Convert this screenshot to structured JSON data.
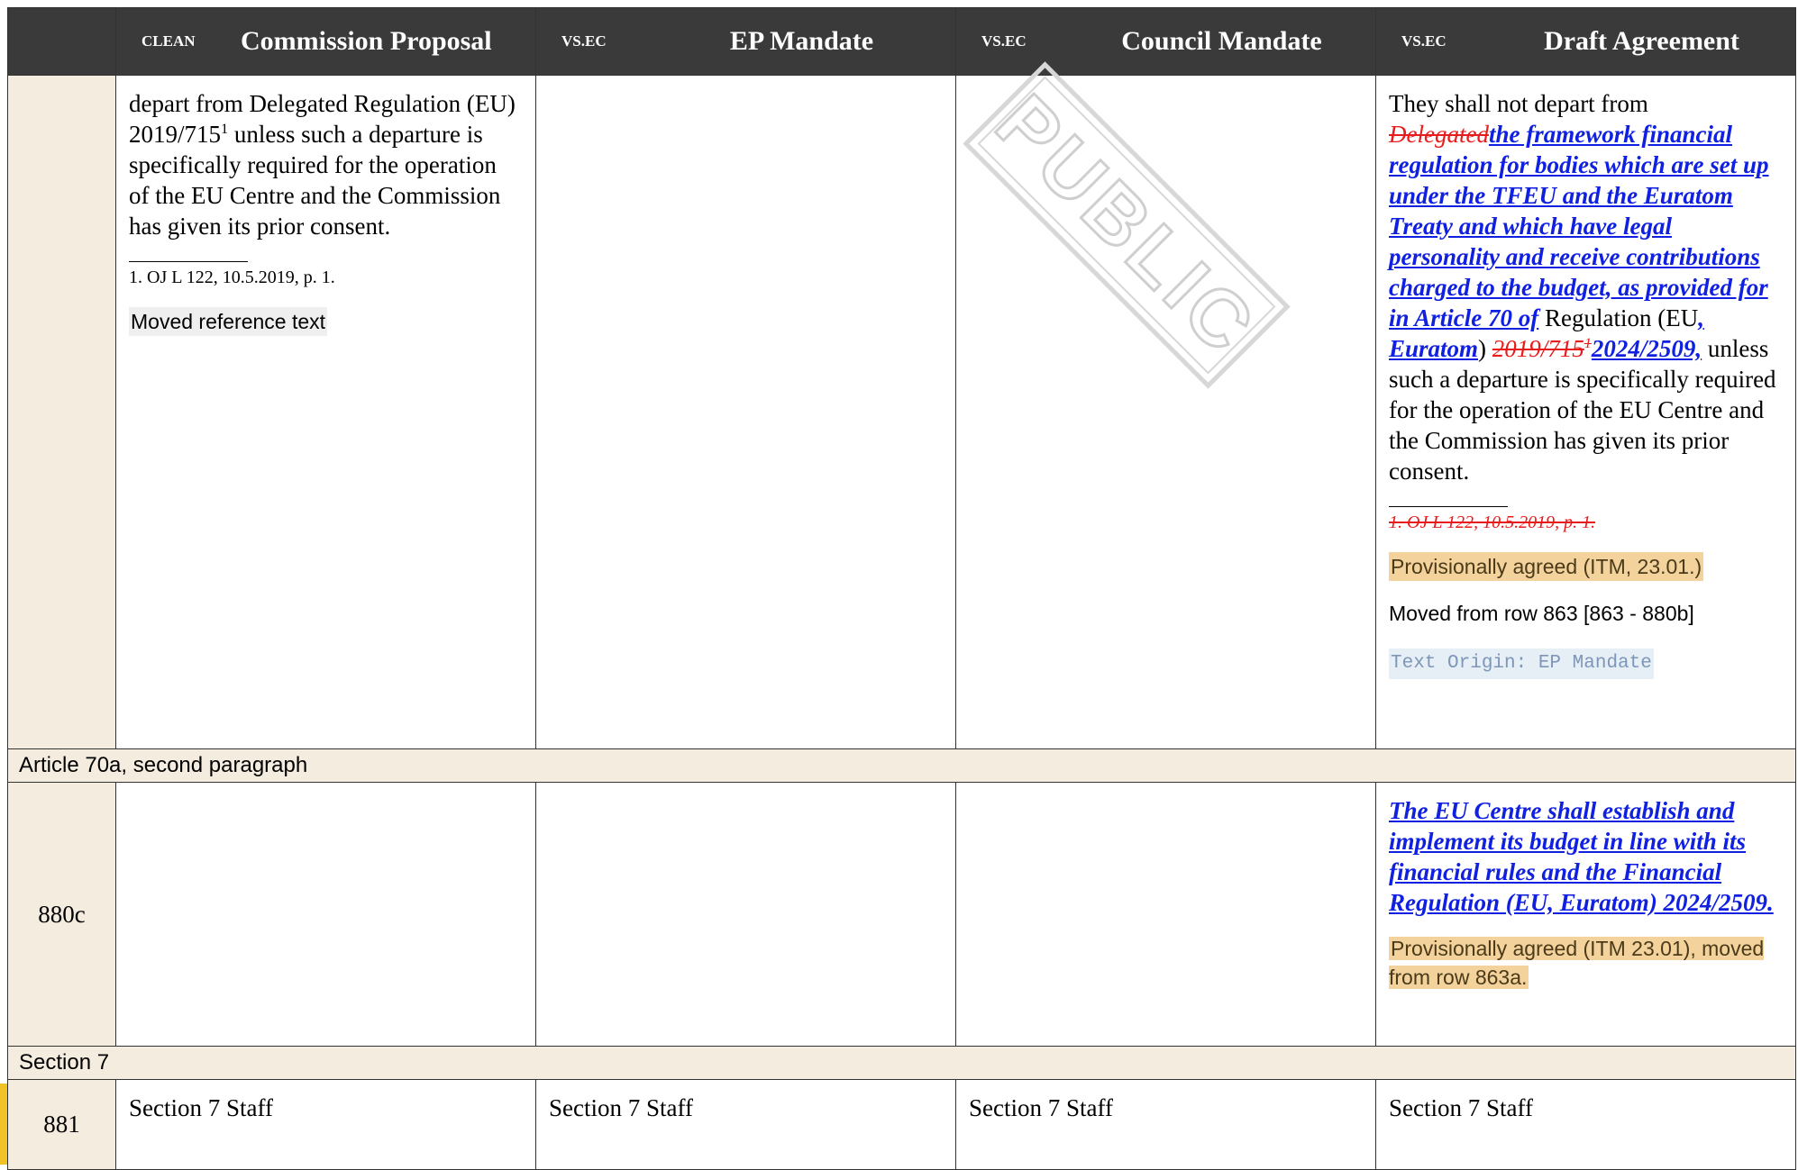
{
  "header": {
    "col1": {
      "tag": "CLEAN",
      "title": "Commission Proposal"
    },
    "col2": {
      "tag": "VS.EC",
      "title": "EP Mandate"
    },
    "col3": {
      "tag": "VS.EC",
      "title": "Council Mandate"
    },
    "col4": {
      "tag": "VS.EC",
      "title": "Draft Agreement"
    }
  },
  "watermark": {
    "text": "PUBLIC"
  },
  "row_a": {
    "commission": {
      "text_1": "depart from Delegated Regulation (EU) 2019/715",
      "sup": "1",
      "text_2": " unless such a departure is specifically required for the operation of the EU Centre and the Commission has given its prior consent.",
      "footnote": "1. OJ L 122, 10.5.2019, p. 1.",
      "note": "Moved reference text"
    },
    "draft": {
      "t1": "They shall not depart from ",
      "del1": "Delegated",
      "ins1": "the framework financial regulation for bodies which are set up under the TFEU and the Euratom Treaty and which have legal personality and receive contributions charged to the budget, as provided for in Article 70 of",
      "t2": " Regulation (EU",
      "ins2": ", Euratom",
      "t3": ")",
      "del2": "2019/715",
      "del2_sup": "1",
      "ins3": "2024/2509,",
      "t4": " unless such a departure is specifically required for the operation of the EU Centre and the Commission has given its prior consent.",
      "footnote_del": "1. OJ L 122, 10.5.2019, p. 1.",
      "note_gold": "Provisionally agreed (ITM, 23.01.)",
      "note_moved": "Moved from row 863 [863 - 880b]",
      "origin": "Text Origin: EP Mandate"
    }
  },
  "section_1": {
    "label": "Article 70a, second paragraph"
  },
  "row_b": {
    "number": "880c",
    "draft": {
      "ins": "The EU Centre shall establish and implement its budget in line with its financial rules and the Financial Regulation (EU, Euratom) 2024/2509.",
      "note_gold": "Provisionally agreed (ITM 23.01), moved from row 863a."
    }
  },
  "section_2": {
    "label": "Section 7"
  },
  "row_c": {
    "number": "881",
    "commission": "Section 7 Staff",
    "ep": "Section 7 Staff",
    "council": "Section 7 Staff",
    "draft": "Section 7 Staff"
  }
}
